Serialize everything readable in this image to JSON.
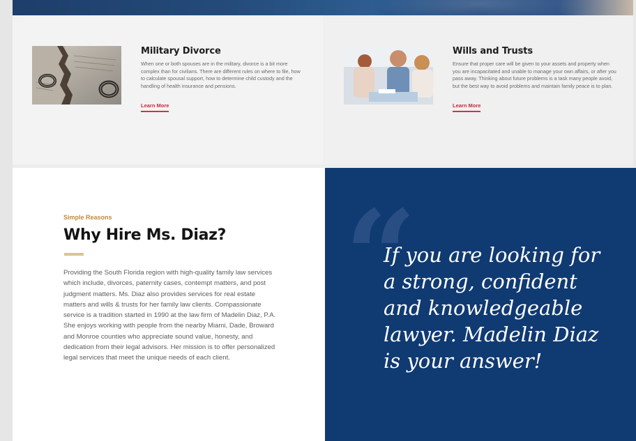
{
  "services": [
    {
      "title": "Military Divorce",
      "description": "When one or both spouses are in the military, divorce is a bit more complex than for civilians. There are different rules on where to file, how to calculate spousal support, how to determine child custody and the handling of health insurance and pensions.",
      "link_label": "Learn More",
      "image": "wedding-rings-divorce-decree-photo"
    },
    {
      "title": "Wills and Trusts",
      "description": "Ensure that proper care will be given to your assets and property when you are incapacitated and unable to manage your own affairs, or after you pass away. Thinking about future problems is a task many people avoid, but the best way to avoid problems and maintain family peace is to plan.",
      "link_label": "Learn More",
      "image": "family-meeting-advisor-photo"
    }
  ],
  "why": {
    "eyebrow": "Simple Reasons",
    "title": "Why Hire Ms. Diaz?",
    "body": "Providing the South Florida region with high-quality family law services which include, divorces, paternity cases, contempt matters, and post judgment matters. Ms. Diaz also provides services for real estate matters and wills & trusts for her family law clients. Compassionate service is a tradition started in 1990 at the law firm of Madelin Diaz, P.A. She enjoys working with people from the nearby Miami, Dade, Broward and Monroe counties who appreciate sound value, honesty, and dedication from their legal advisors. Her mission is to offer personalized legal services that meet the unique needs of each client."
  },
  "quote": {
    "mark": "“",
    "text": "If you are looking for a strong, confident and knowledgeable lawyer. Madelin Diaz is your answer!"
  },
  "colors": {
    "navy": "#103a72",
    "accent_red": "#c6293b",
    "gold": "#c08a3e"
  }
}
